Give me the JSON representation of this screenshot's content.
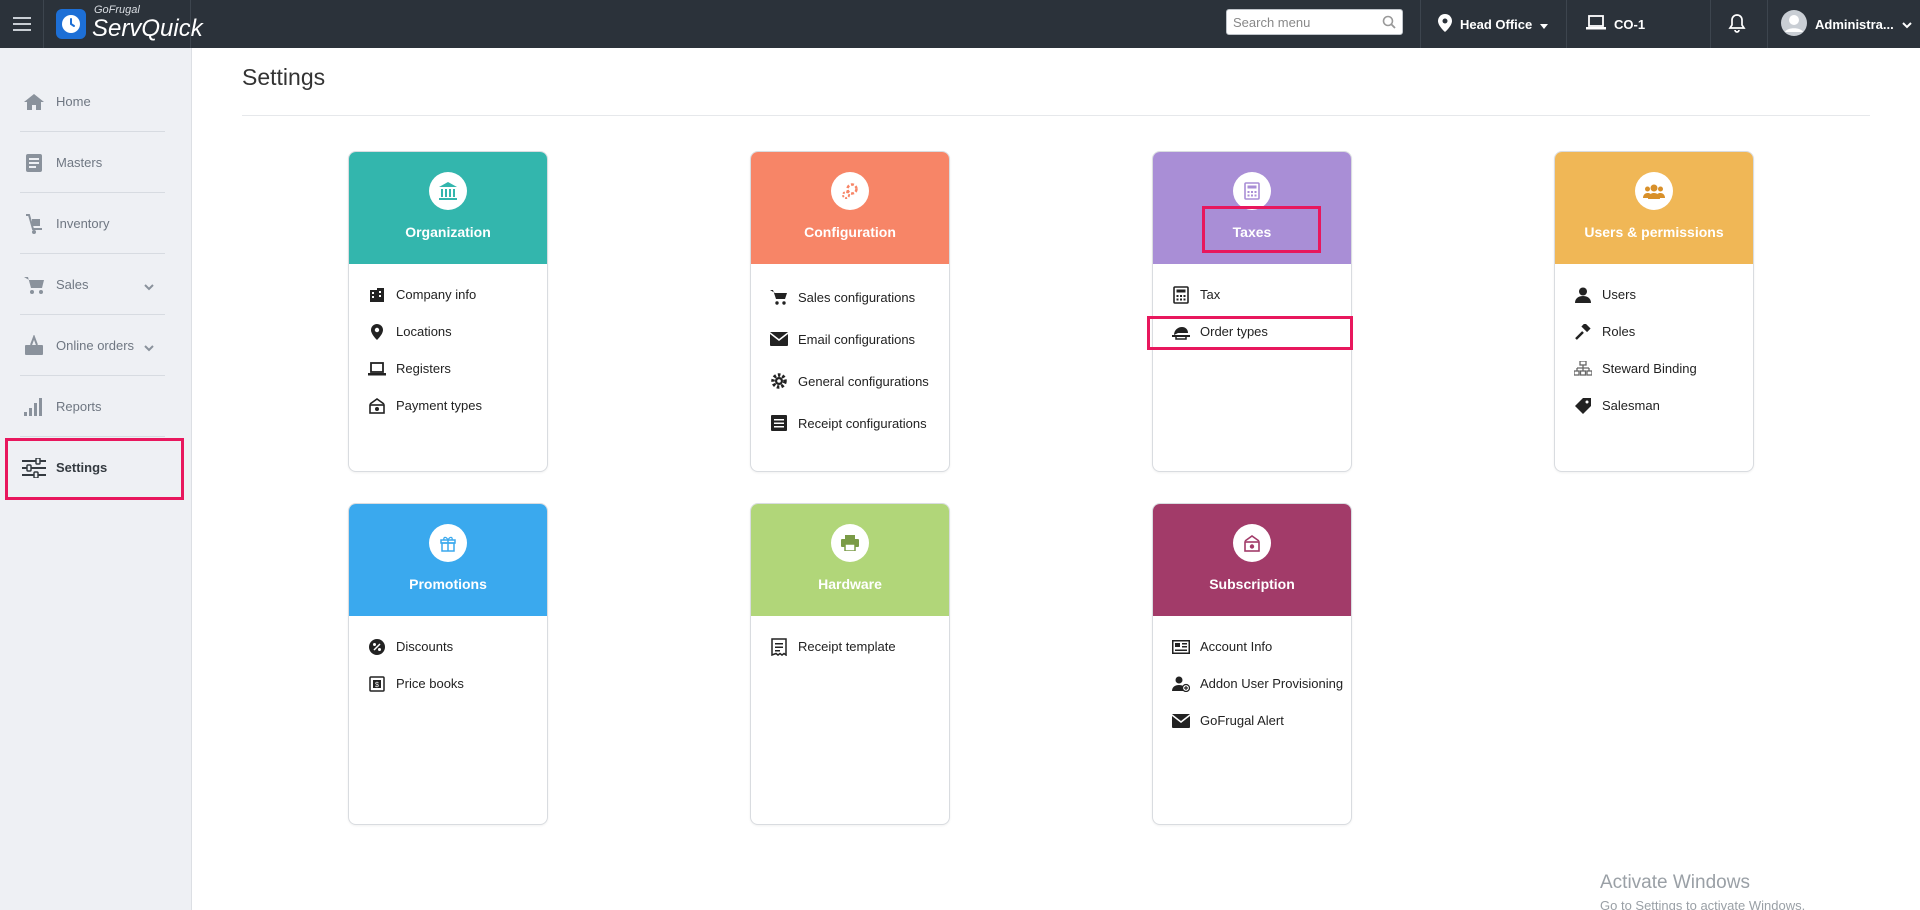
{
  "topbar": {
    "logo_small": "GoFrugal",
    "logo_big": "ServQuick",
    "search_placeholder": "Search menu",
    "location": "Head Office",
    "register": "CO-1",
    "user": "Administra..."
  },
  "sidebar": {
    "items": [
      {
        "label": "Home",
        "icon": "home-icon"
      },
      {
        "label": "Masters",
        "icon": "masters-icon"
      },
      {
        "label": "Inventory",
        "icon": "inventory-icon"
      },
      {
        "label": "Sales",
        "icon": "cart-icon",
        "expandable": true
      },
      {
        "label": "Online orders",
        "icon": "online-orders-icon",
        "expandable": true
      },
      {
        "label": "Reports",
        "icon": "reports-icon"
      },
      {
        "label": "Settings",
        "icon": "sliders-icon",
        "active": true
      }
    ]
  },
  "page": {
    "title": "Settings"
  },
  "cards": [
    {
      "title": "Organization",
      "color": "#33b6ad",
      "icon": "bank-icon",
      "links": [
        {
          "label": "Company info",
          "icon": "building-icon"
        },
        {
          "label": "Locations",
          "icon": "map-pin-icon"
        },
        {
          "label": "Registers",
          "icon": "laptop-icon"
        },
        {
          "label": "Payment types",
          "icon": "payment-icon"
        }
      ]
    },
    {
      "title": "Configuration",
      "color": "#f78567",
      "icon": "gears-icon",
      "links": [
        {
          "label": "Sales configurations",
          "icon": "cart-icon"
        },
        {
          "label": "Email configurations",
          "icon": "envelope-icon"
        },
        {
          "label": "General configurations",
          "icon": "gear-icon"
        },
        {
          "label": "Receipt configurations",
          "icon": "list-icon"
        }
      ]
    },
    {
      "title": "Taxes",
      "color": "#a98ed6",
      "icon": "calculator-icon",
      "links": [
        {
          "label": "Tax",
          "icon": "calculator-icon"
        },
        {
          "label": "Order types",
          "icon": "order-type-icon"
        }
      ]
    },
    {
      "title": "Users & permissions",
      "color": "#f0b756",
      "icon": "users-icon",
      "links": [
        {
          "label": "Users",
          "icon": "user-icon"
        },
        {
          "label": "Roles",
          "icon": "gavel-icon"
        },
        {
          "label": "Steward Binding",
          "icon": "sitemap-icon"
        },
        {
          "label": "Salesman",
          "icon": "tag-icon"
        }
      ]
    },
    {
      "title": "Promotions",
      "color": "#3aa9ee",
      "icon": "gift-icon",
      "links": [
        {
          "label": "Discounts",
          "icon": "percent-icon"
        },
        {
          "label": "Price books",
          "icon": "price-book-icon"
        }
      ]
    },
    {
      "title": "Hardware",
      "color": "#b1d679",
      "icon": "printer-icon",
      "links": [
        {
          "label": "Receipt template",
          "icon": "receipt-icon"
        }
      ]
    },
    {
      "title": "Subscription",
      "color": "#a23b69",
      "icon": "subscription-icon",
      "links": [
        {
          "label": "Account Info",
          "icon": "account-card-icon"
        },
        {
          "label": "Addon User Provisioning",
          "icon": "user-addon-icon"
        },
        {
          "label": "GoFrugal Alert",
          "icon": "envelope-icon"
        }
      ]
    }
  ],
  "watermark": {
    "line1": "Activate Windows",
    "line2": "Go to Settings to activate Windows."
  }
}
